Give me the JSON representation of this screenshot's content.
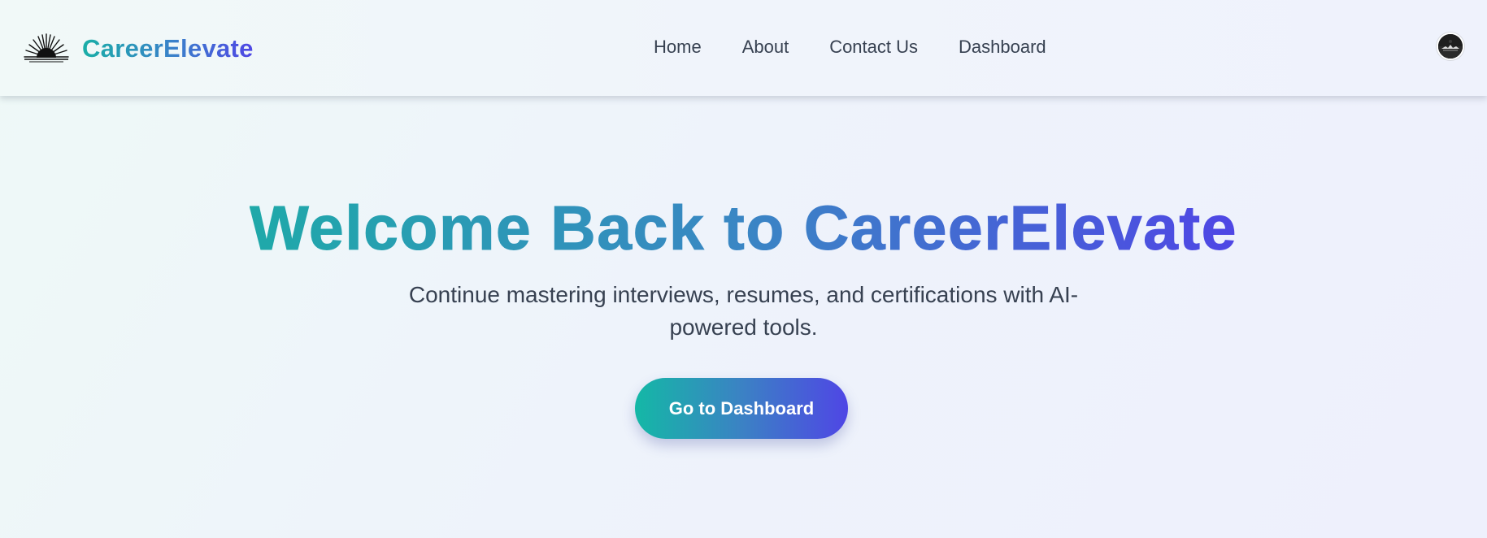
{
  "brand": {
    "logo_icon": "sunburst-logo-icon",
    "name": "CareerElevate"
  },
  "nav": {
    "items": [
      {
        "label": "Home"
      },
      {
        "label": "About"
      },
      {
        "label": "Contact Us"
      },
      {
        "label": "Dashboard"
      }
    ]
  },
  "user": {
    "avatar_icon": "user-avatar-icon"
  },
  "hero": {
    "title": "Welcome Back to CareerElevate",
    "subtitle": "Continue mastering interviews, resumes, and certifications with AI-powered tools.",
    "cta_label": "Go to Dashboard"
  },
  "colors": {
    "gradient_start": "#14b8a6",
    "gradient_mid": "#3b82c4",
    "gradient_end": "#4f46e5",
    "text": "#374151",
    "background": "#eef3fb"
  }
}
